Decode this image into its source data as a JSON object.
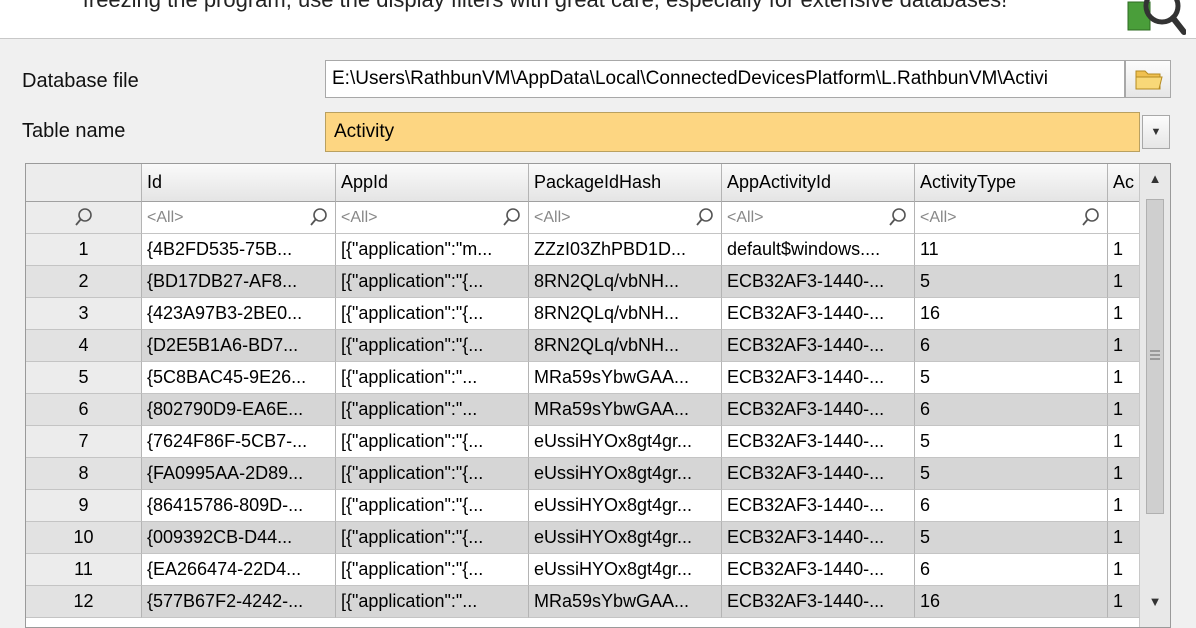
{
  "banner": {
    "text": "freezing the program, use the display filters with great care, especially for extensive databases!"
  },
  "form": {
    "db_label": "Database file",
    "db_path": "E:\\Users\\RathbunVM\\AppData\\Local\\ConnectedDevicesPlatform\\L.RathbunVM\\Activi",
    "table_label": "Table name",
    "table_value": "Activity"
  },
  "grid": {
    "columns": [
      "Id",
      "AppId",
      "PackageIdHash",
      "AppActivityId",
      "ActivityType",
      "Ac"
    ],
    "filter_text": "<All>",
    "rows": [
      [
        "1",
        "{4B2FD535-75B...",
        "[{\"application\":\"m...",
        "ZZzI03ZhPBD1D...",
        "default$windows....",
        "11",
        "1"
      ],
      [
        "2",
        "{BD17DB27-AF8...",
        "[{\"application\":\"{...",
        "8RN2QLq/vbNH...",
        "ECB32AF3-1440-...",
        "5",
        "1"
      ],
      [
        "3",
        "{423A97B3-2BE0...",
        "[{\"application\":\"{...",
        "8RN2QLq/vbNH...",
        "ECB32AF3-1440-...",
        "16",
        "1"
      ],
      [
        "4",
        "{D2E5B1A6-BD7...",
        "[{\"application\":\"{...",
        "8RN2QLq/vbNH...",
        "ECB32AF3-1440-...",
        "6",
        "1"
      ],
      [
        "5",
        "{5C8BAC45-9E26...",
        "[{\"application\":\"...",
        "MRa59sYbwGAA...",
        "ECB32AF3-1440-...",
        "5",
        "1"
      ],
      [
        "6",
        "{802790D9-EA6E...",
        "[{\"application\":\"...",
        "MRa59sYbwGAA...",
        "ECB32AF3-1440-...",
        "6",
        "1"
      ],
      [
        "7",
        "{7624F86F-5CB7-...",
        "[{\"application\":\"{...",
        "eUssiHYOx8gt4gr...",
        "ECB32AF3-1440-...",
        "5",
        "1"
      ],
      [
        "8",
        "{FA0995AA-2D89...",
        "[{\"application\":\"{...",
        "eUssiHYOx8gt4gr...",
        "ECB32AF3-1440-...",
        "5",
        "1"
      ],
      [
        "9",
        "{86415786-809D-...",
        "[{\"application\":\"{...",
        "eUssiHYOx8gt4gr...",
        "ECB32AF3-1440-...",
        "6",
        "1"
      ],
      [
        "10",
        "{009392CB-D44...",
        "[{\"application\":\"{...",
        "eUssiHYOx8gt4gr...",
        "ECB32AF3-1440-...",
        "5",
        "1"
      ],
      [
        "11",
        "{EA266474-22D4...",
        "[{\"application\":\"{...",
        "eUssiHYOx8gt4gr...",
        "ECB32AF3-1440-...",
        "6",
        "1"
      ],
      [
        "12",
        "{577B67F2-4242-...",
        "[{\"application\":\"...",
        "MRa59sYbwGAA...",
        "ECB32AF3-1440-...",
        "16",
        "1"
      ]
    ]
  },
  "icons": {
    "banner": "magnifier-icon",
    "browse": "folder-icon",
    "filter": "search-icon",
    "dropdown": "chevron-down-icon"
  },
  "colors": {
    "table_name_highlight": "#fdd682",
    "alt_row": "#d6d6d6"
  }
}
